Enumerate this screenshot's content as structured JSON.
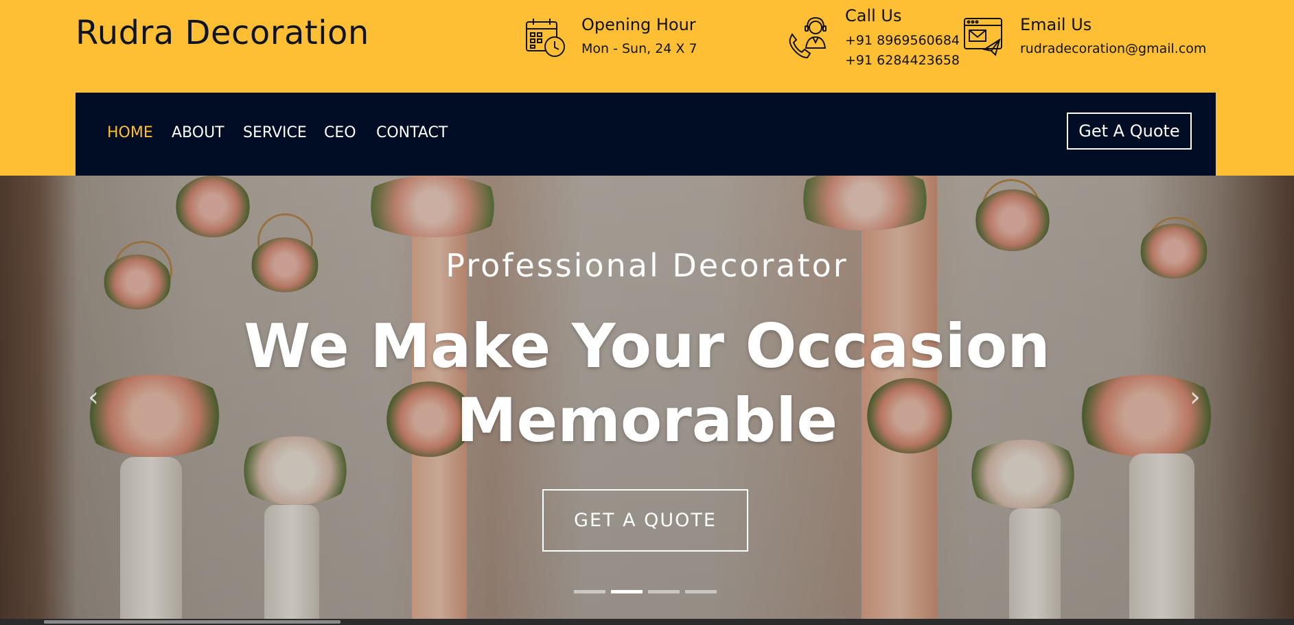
{
  "brand": {
    "name": "Rudra Decoration"
  },
  "topbar": {
    "opening": {
      "icon": "calendar-clock-icon",
      "title": "Opening Hour",
      "text": "Mon - Sun, 24 X 7"
    },
    "call": {
      "icon": "phone-support-icon",
      "title": "Call Us",
      "phone1": "+91 8969560684",
      "phone2": "+91 6284423658"
    },
    "email": {
      "icon": "email-browser-icon",
      "title": "Email Us",
      "text": "rudradecoration@gmail.com"
    }
  },
  "nav": {
    "items": [
      {
        "label": "HOME",
        "active": true
      },
      {
        "label": "ABOUT"
      },
      {
        "label": "SERVICE"
      },
      {
        "label": "CEO"
      },
      {
        "label": "CONTACT"
      }
    ],
    "quote_button": "Get A Quote"
  },
  "hero": {
    "subtitle": "Professional Decorator",
    "headline_line1": "We Make Your Occasion",
    "headline_line2": "Memorable",
    "button": "GET A QUOTE",
    "prev_icon": "chevron-left-icon",
    "next_icon": "chevron-right-icon",
    "slides_count": 4,
    "active_slide": 2
  },
  "colors": {
    "accent": "#FEBF34",
    "navbar": "#000D25",
    "text_dark": "#0f1422",
    "white": "#ffffff"
  }
}
